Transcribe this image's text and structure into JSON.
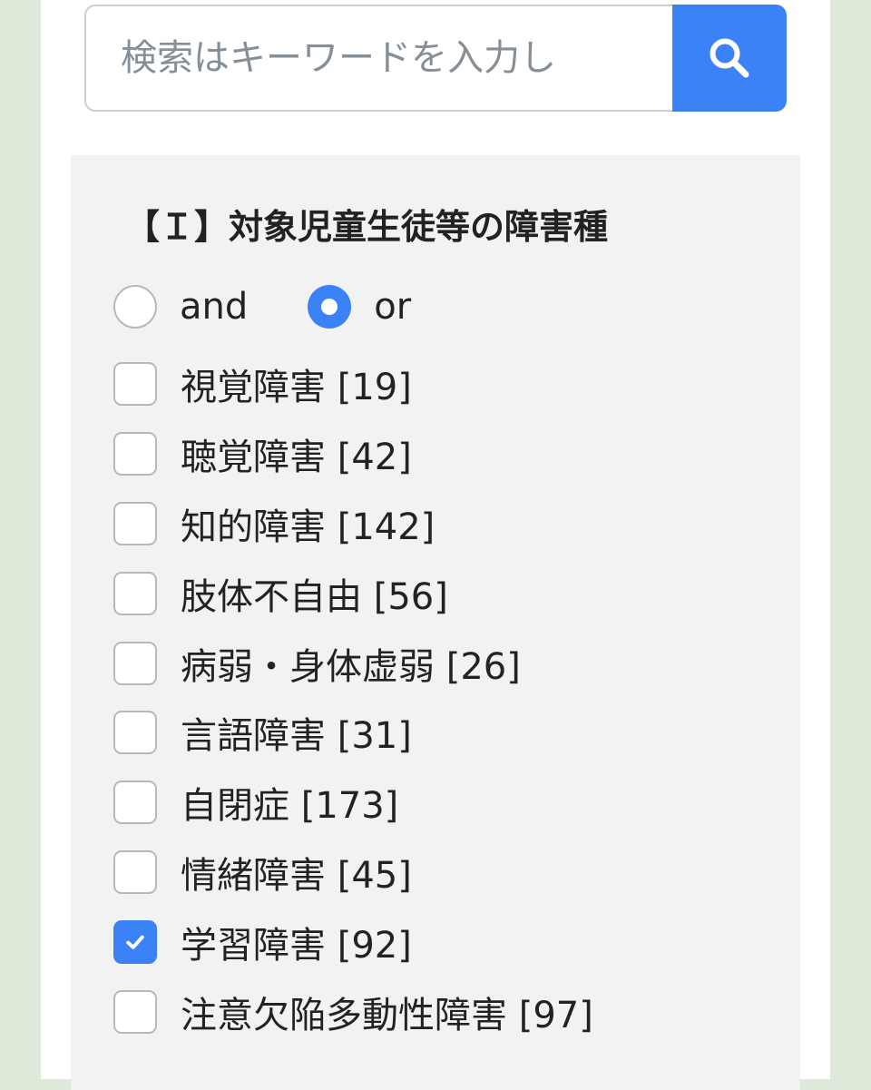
{
  "search": {
    "placeholder": "検索はキーワードを入力し",
    "button_icon": "search-icon"
  },
  "filter": {
    "title": "【Ｉ】対象児童生徒等の障害種",
    "mode_options": [
      {
        "label": "and",
        "selected": false
      },
      {
        "label": "or",
        "selected": true
      }
    ],
    "categories": [
      {
        "label": "視覚障害 [19]",
        "checked": false
      },
      {
        "label": "聴覚障害 [42]",
        "checked": false
      },
      {
        "label": "知的障害 [142]",
        "checked": false
      },
      {
        "label": "肢体不自由 [56]",
        "checked": false
      },
      {
        "label": "病弱・身体虚弱 [26]",
        "checked": false
      },
      {
        "label": "言語障害 [31]",
        "checked": false
      },
      {
        "label": "自閉症 [173]",
        "checked": false
      },
      {
        "label": "情緒障害 [45]",
        "checked": false
      },
      {
        "label": "学習障害 [92]",
        "checked": true
      },
      {
        "label": "注意欠陥多動性障害 [97]",
        "checked": false
      }
    ]
  },
  "colors": {
    "accent": "#3b82f6",
    "page_background": "#dfe9d9",
    "panel_background": "#f2f2f2",
    "border": "#b4b9bf"
  }
}
